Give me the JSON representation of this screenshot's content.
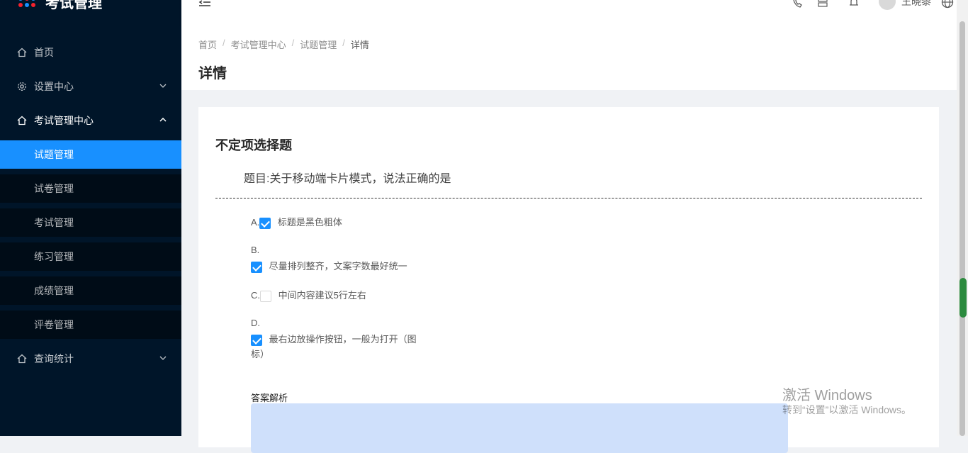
{
  "sidebar": {
    "title": "考试管理",
    "menu": [
      {
        "label": "首页",
        "icon": "home-icon"
      },
      {
        "label": "设置中心",
        "icon": "gear-icon"
      },
      {
        "label": "考试管理中心",
        "icon": "home-icon"
      },
      {
        "label": "查询统计",
        "icon": "home-icon"
      }
    ],
    "submenu": [
      {
        "label": "试题管理"
      },
      {
        "label": "试卷管理"
      },
      {
        "label": "考试管理"
      },
      {
        "label": "练习管理"
      },
      {
        "label": "成绩管理"
      },
      {
        "label": "评卷管理"
      }
    ]
  },
  "header": {
    "username": "王晓黎"
  },
  "breadcrumb": [
    "首页",
    "考试管理中心",
    "试题管理",
    "详情"
  ],
  "page_title": "详情",
  "question": {
    "type": "不定项选择题",
    "text": "题目:关于移动端卡片模式，说法正确的是",
    "options": [
      {
        "letter": "A.",
        "text": "标题是黑色粗体",
        "checked": true
      },
      {
        "letter": "B.",
        "text": "尽量排列整齐，文案字数最好统一",
        "checked": true
      },
      {
        "letter": "C.",
        "text": "中间内容建议5行左右",
        "checked": false
      },
      {
        "letter": "D.",
        "text_line1": "最右边放操作按钮，一般为打开（图",
        "text_line2": "标）",
        "checked": true
      }
    ],
    "analysis_label": "答案解析"
  },
  "watermark": {
    "line1": "激活 Windows",
    "line2": "转到“设置”以激活 Windows。"
  },
  "colors": {
    "sidebar_bg": "#001529",
    "accent": "#1890ff"
  }
}
